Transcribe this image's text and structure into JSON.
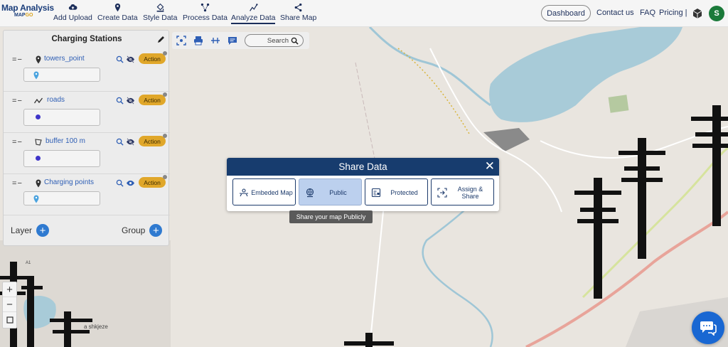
{
  "brand": {
    "line1": "Map Analysis",
    "line2_a": "MAP",
    "line2_b": "GO"
  },
  "nav": [
    {
      "label": "Add Upload",
      "icon": "cloud-upload-icon"
    },
    {
      "label": "Create Data",
      "icon": "location-pin-icon"
    },
    {
      "label": "Style Data",
      "icon": "paint-bucket-icon"
    },
    {
      "label": "Process Data",
      "icon": "process-nodes-icon"
    },
    {
      "label": "Analyze Data",
      "icon": "analyze-chart-icon"
    },
    {
      "label": "Share Map",
      "icon": "share-icon"
    }
  ],
  "top_right": {
    "dashboard": "Dashboard",
    "contact": "Contact us",
    "faq": "FAQ",
    "pricing": "Pricing |",
    "avatar_letter": "S"
  },
  "panel": {
    "title": "Charging Stations",
    "layers": [
      {
        "name": "towers_point",
        "type": "point",
        "action": "Action",
        "visible": false
      },
      {
        "name": "roads",
        "type": "line",
        "action": "Action",
        "visible": false
      },
      {
        "name": "buffer 100 m",
        "type": "polygon",
        "action": "Action",
        "visible": false
      },
      {
        "name": "Charging points",
        "type": "point",
        "action": "Action",
        "visible": true
      }
    ],
    "footer_layer": "Layer",
    "footer_group": "Group"
  },
  "map_toolbar": {
    "search_label": "Search"
  },
  "zoom": {
    "in": "+",
    "out": "−"
  },
  "modal": {
    "title": "Share Data",
    "close": "✕",
    "options": [
      {
        "label": "Embeded Map",
        "icon": "embed-icon",
        "selected": false
      },
      {
        "label": "Public",
        "icon": "public-globe-icon",
        "selected": true
      },
      {
        "label": "Protected",
        "icon": "protected-doc-icon",
        "selected": false
      },
      {
        "label": "Assign & Share",
        "icon": "assign-share-icon",
        "selected": false
      }
    ],
    "tooltip": "Share your map Publicly"
  },
  "map_labels": {
    "village": "a shkjeze",
    "road_a1": "A1"
  },
  "colors": {
    "nav_text": "#1c2e5a",
    "modal_header": "#173c6e",
    "action": "#e0a72a",
    "selected_option": "#bcd0ee",
    "chat": "#1967d2",
    "avatar": "#1b7a3a"
  }
}
